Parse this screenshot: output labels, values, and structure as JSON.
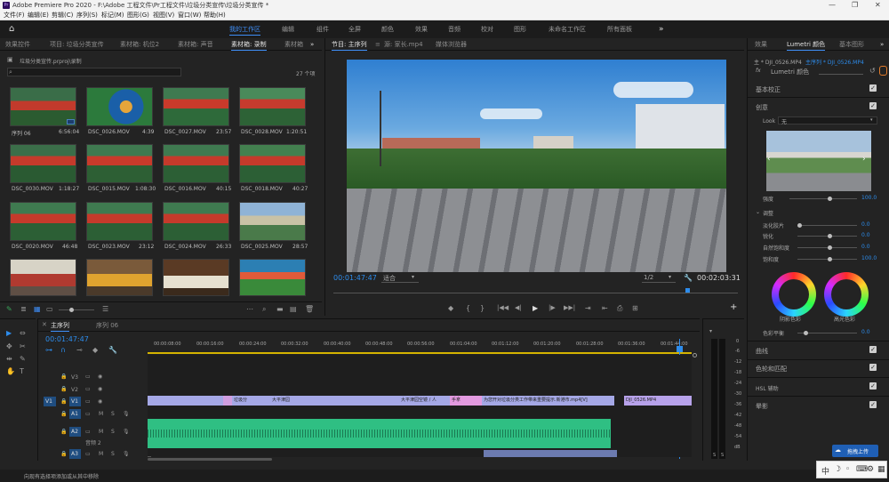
{
  "window": {
    "title": "Adobe Premiere Pro 2020 - F:\\Adobe 工程文件\\Pr工程文件\\垃圾分类宣传\\垃圾分类宣传 *",
    "logo": "Pr",
    "controls": [
      "—",
      "❐",
      "✕"
    ]
  },
  "menu": [
    "文件(F)",
    "编辑(E)",
    "剪辑(C)",
    "序列(S)",
    "标记(M)",
    "图形(G)",
    "视图(V)",
    "窗口(W)",
    "帮助(H)"
  ],
  "workspaces": {
    "home_icon": "home-icon",
    "items": [
      "我的工作区",
      "编辑",
      "组件",
      "全屏",
      "颜色",
      "效果",
      "音频",
      "校对",
      "图形",
      "未命名工作区",
      "所有面板"
    ],
    "active": 0,
    "more": "»"
  },
  "project": {
    "tabs": [
      "效果控件",
      "项目: 垃圾分类宣传",
      "素材箱: 机位2",
      "素材箱: 声音",
      "素材箱: 录制",
      "素材箱"
    ],
    "active_tab": 4,
    "more": "»",
    "path": "垃圾分类宣传.prproj\\录制",
    "search_placeholder": "",
    "item_count": "27 个项",
    "items": [
      {
        "name": "序列 06",
        "dur": "6:56:04"
      },
      {
        "name": "DSC_0026.MOV",
        "dur": "4:39"
      },
      {
        "name": "DSC_0027.MOV",
        "dur": "23:57"
      },
      {
        "name": "DSC_0028.MOV",
        "dur": "1:20:51"
      },
      {
        "name": "DSC_0030.MOV",
        "dur": "1:18:27"
      },
      {
        "name": "DSC_0015.MOV",
        "dur": "1:08:30"
      },
      {
        "name": "DSC_0016.MOV",
        "dur": "40:15"
      },
      {
        "name": "DSC_0018.MOV",
        "dur": "40:27"
      },
      {
        "name": "DSC_0020.MOV",
        "dur": "46:48"
      },
      {
        "name": "DSC_0023.MOV",
        "dur": "23:12"
      },
      {
        "name": "DSC_0024.MOV",
        "dur": "26:33"
      },
      {
        "name": "DSC_0025.MOV",
        "dur": "28:57"
      },
      {
        "name": "",
        "dur": ""
      },
      {
        "name": "",
        "dur": ""
      },
      {
        "name": "",
        "dur": ""
      },
      {
        "name": "",
        "dur": ""
      }
    ]
  },
  "program": {
    "tabs": [
      "节目: 主序列",
      "源: 家长.mp4",
      "媒体浏览器"
    ],
    "active_tab": 0,
    "menu_icon": "≡",
    "timecode": "00:01:47:47",
    "fit": "适合",
    "resolution": "1/2",
    "duration": "00:02:03:31",
    "transport": [
      "◆",
      "{",
      "}",
      "|◀◀",
      "◀|",
      "▶",
      "|▶",
      "▶▶|",
      "⇥",
      "⇤",
      "⎙",
      "⊞"
    ],
    "add": "+"
  },
  "lumetri": {
    "tabs": [
      "效果",
      "Lumetri 颜色",
      "基本图形"
    ],
    "active_tab": 1,
    "more": "»",
    "clip_selector": "主 * DJI_0526.MP4",
    "clip_target": "主序列 * DJI_0526.MP4",
    "fx_label": "fx",
    "fx_name": "Lumetri 颜色",
    "sections": [
      "基本校正",
      "创意"
    ],
    "look_label": "Look",
    "look_value": "无",
    "intensity_label": "强度",
    "intensity_value": "100.0",
    "adjust_title": "调整",
    "adjust_rows": [
      {
        "label": "淡化胶片",
        "value": "0.0"
      },
      {
        "label": "锐化",
        "value": "0.0"
      },
      {
        "label": "自然饱和度",
        "value": "0.0"
      },
      {
        "label": "饱和度",
        "value": "100.0"
      }
    ],
    "wheel_labels": [
      "阴影色彩",
      "高光色彩"
    ],
    "balance_label": "色彩平衡",
    "balance_value": "0.0",
    "other_sections": [
      "曲线",
      "色轮和匹配",
      "HSL 辅助",
      "晕影"
    ],
    "upload_label": "拖拽上传"
  },
  "timeline": {
    "tabs": [
      "主序列",
      "序列 06"
    ],
    "active_tab": 0,
    "timecode": "00:01:47:47",
    "ruler": [
      "00:00:00:00",
      "00:00:08:00",
      "00:00:16:00",
      "00:00:24:00",
      "00:00:32:00",
      "00:00:40:00",
      "00:00:48:00",
      "00:00:56:00",
      "00:01:04:00",
      "00:01:12:00",
      "00:01:20:00",
      "00:01:28:00",
      "00:01:36:00",
      "00:01:44:00"
    ],
    "tracks": [
      {
        "id": "V3",
        "lock": "🔒",
        "eye": "👁"
      },
      {
        "id": "V2",
        "lock": "🔒",
        "eye": "👁"
      },
      {
        "id": "V1",
        "lock": "🔒",
        "eye": "👁"
      },
      {
        "id": "A1",
        "m": "M",
        "s": "S"
      },
      {
        "id": "A2",
        "m": "M",
        "s": "S"
      },
      {
        "id": "A3",
        "m": "M",
        "s": "S"
      }
    ],
    "track_name_a2": "音频 2",
    "clips_v1": [
      "垃圾分",
      "大平津园",
      "大平津园空镜 / 人",
      "手拿",
      "为您开对垃圾分类工作带来重要提示.新港市.mp4[V]",
      "DJI_0526.MP4"
    ],
    "meter_scale": [
      "0",
      "-6",
      "-12",
      "-18",
      "-24",
      "-30",
      "-36",
      "-42",
      "-48",
      "-54",
      "dB"
    ],
    "meter_buttons": [
      "S",
      "S"
    ]
  },
  "tools": [
    "▶",
    "⇔",
    "✥",
    "⇹",
    "✎",
    "✋",
    "T",
    "🔍"
  ],
  "status": "向现有选择项添加或从其中移除",
  "ime": [
    "中",
    "☽",
    "◦",
    "⌨",
    "⚙",
    "▦"
  ]
}
